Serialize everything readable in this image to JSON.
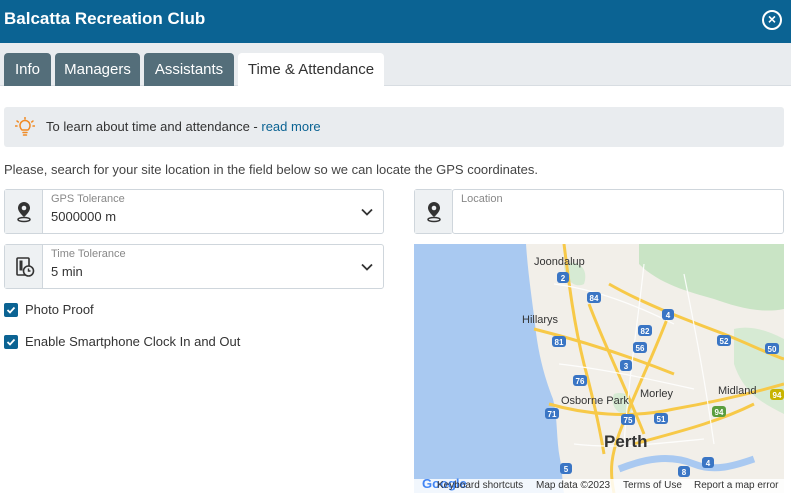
{
  "window": {
    "title": "Balcatta Recreation Club",
    "close_icon": "close-circle-icon"
  },
  "tabs": [
    {
      "label": "Info",
      "active": false
    },
    {
      "label": "Managers",
      "active": false
    },
    {
      "label": "Assistants",
      "active": false
    },
    {
      "label": "Time & Attendance",
      "active": true
    }
  ],
  "info_banner": {
    "icon": "lightbulb-icon",
    "text": "To learn about time and attendance - ",
    "link": "read more"
  },
  "instruction": "Please, search for your site location in the field below so we can locate the GPS coordinates.",
  "gps_tolerance": {
    "icon": "map-pin-icon",
    "label": "GPS Tolerance",
    "value": "5000000 m"
  },
  "time_tolerance": {
    "icon": "time-tolerance-icon",
    "label": "Time Tolerance",
    "value": "5 min"
  },
  "location": {
    "icon": "map-pin-icon",
    "placeholder": "Location",
    "value": ""
  },
  "checkboxes": [
    {
      "label": "Photo Proof",
      "checked": true
    },
    {
      "label": "Enable Smartphone Clock In and Out",
      "checked": true
    }
  ],
  "map": {
    "places": [
      "Joondalup",
      "Hillarys",
      "Osborne Park",
      "Morley",
      "Midland",
      "Perth"
    ],
    "road_shields": [
      "2",
      "84",
      "4",
      "82",
      "81",
      "56",
      "52",
      "50",
      "3",
      "76",
      "75",
      "94",
      "71",
      "51",
      "94",
      "5",
      "8",
      "4"
    ],
    "attribution": {
      "logo": "Google",
      "shortcuts": "Keyboard shortcuts",
      "data": "Map data ©2023",
      "terms": "Terms of Use",
      "report": "Report a map error"
    },
    "colors": {
      "water": "#a9c9f1",
      "land": "#f2efe9",
      "park": "#c9e4c5",
      "road": "#f7c948"
    }
  }
}
